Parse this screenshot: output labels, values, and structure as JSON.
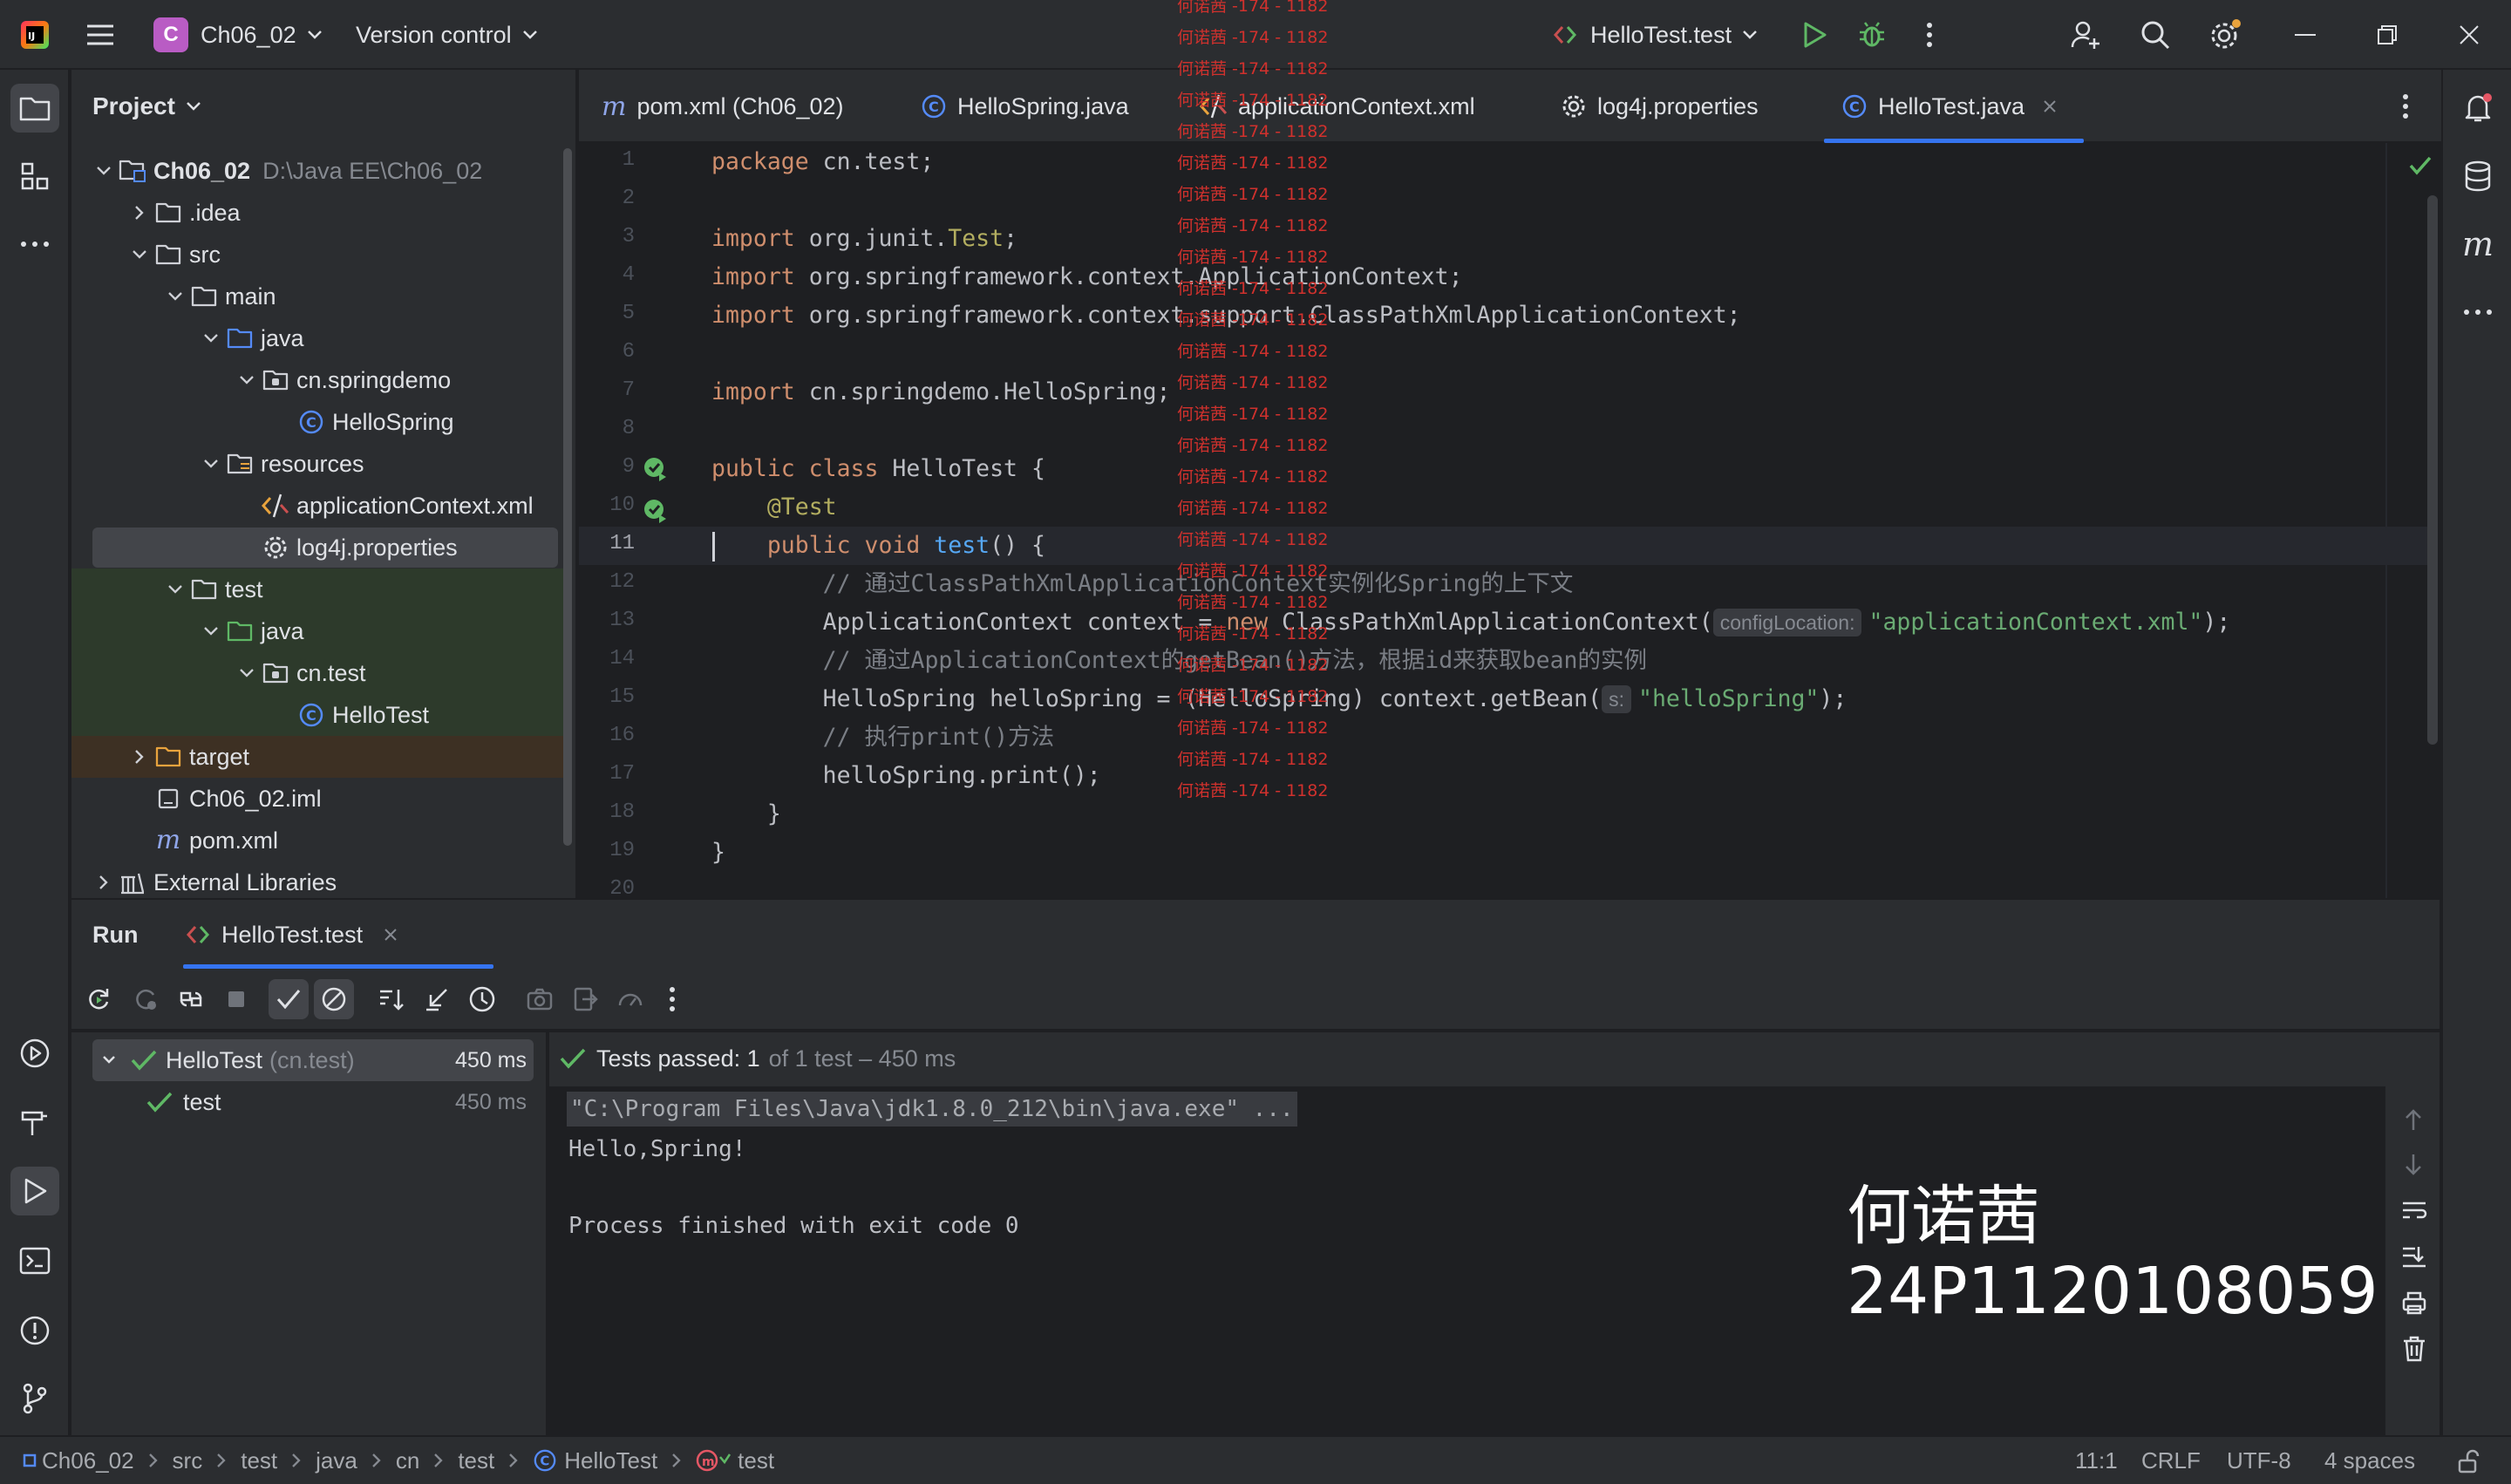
{
  "titlebar": {
    "project_badge": "C",
    "project_name": "Ch06_02",
    "vcs_label": "Version control",
    "run_config": "HelloTest.test"
  },
  "project_panel": {
    "title": "Project",
    "tree": [
      {
        "label": "Ch06_02",
        "extra": "D:\\Java EE\\Ch06_02",
        "icon": "module-folder-icon",
        "indent": 0,
        "state": "open"
      },
      {
        "label": ".idea",
        "icon": "folder-icon",
        "indent": 1,
        "state": "closed"
      },
      {
        "label": "src",
        "icon": "folder-icon",
        "indent": 1,
        "state": "open"
      },
      {
        "label": "main",
        "icon": "folder-icon",
        "indent": 2,
        "state": "open"
      },
      {
        "label": "java",
        "icon": "source-folder-icon",
        "indent": 3,
        "state": "open"
      },
      {
        "label": "cn.springdemo",
        "icon": "package-icon",
        "indent": 4,
        "state": "open"
      },
      {
        "label": "HelloSpring",
        "icon": "class-icon",
        "indent": 5,
        "state": "leaf"
      },
      {
        "label": "resources",
        "icon": "resources-folder-icon",
        "indent": 3,
        "state": "open"
      },
      {
        "label": "applicationContext.xml",
        "icon": "xml-file-icon",
        "indent": 4,
        "state": "leaf"
      },
      {
        "label": "log4j.properties",
        "icon": "properties-file-icon",
        "indent": 4,
        "state": "leaf",
        "selected": true
      },
      {
        "label": "test",
        "icon": "folder-icon",
        "indent": 2,
        "state": "open",
        "tint": "green"
      },
      {
        "label": "java",
        "icon": "test-folder-icon",
        "indent": 3,
        "state": "open",
        "tint": "green"
      },
      {
        "label": "cn.test",
        "icon": "package-icon",
        "indent": 4,
        "state": "open",
        "tint": "green"
      },
      {
        "label": "HelloTest",
        "icon": "class-icon",
        "indent": 5,
        "state": "leaf",
        "tint": "green"
      },
      {
        "label": "target",
        "icon": "excluded-folder-icon",
        "indent": 1,
        "state": "closed",
        "tint": "orange"
      },
      {
        "label": "Ch06_02.iml",
        "icon": "iml-file-icon",
        "indent": 1,
        "state": "leaf"
      },
      {
        "label": "pom.xml",
        "icon": "maven-icon",
        "indent": 1,
        "state": "leaf"
      },
      {
        "label": "External Libraries",
        "icon": "library-icon",
        "indent": 0,
        "state": "closed"
      }
    ]
  },
  "tabs": [
    {
      "label": "pom.xml (Ch06_02)",
      "icon": "maven-icon"
    },
    {
      "label": "HelloSpring.java",
      "icon": "class-icon"
    },
    {
      "label": "applicationContext.xml",
      "icon": "xml-file-icon"
    },
    {
      "label": "log4j.properties",
      "icon": "properties-file-icon"
    },
    {
      "label": "HelloTest.java",
      "icon": "class-icon",
      "active": true
    }
  ],
  "editor": {
    "line_numbers": [
      "1",
      "2",
      "3",
      "4",
      "5",
      "6",
      "7",
      "8",
      "9",
      "10",
      "11",
      "12",
      "13",
      "14",
      "15",
      "16",
      "17",
      "18",
      "19",
      "20"
    ],
    "current_line": "11",
    "lines": {
      "l1_kw": "package",
      "l1_rest": " cn.test;",
      "l3_kw": "import",
      "l3_pkg": " org.junit.",
      "l3_cls": "Test",
      "l3_end": ";",
      "l4_kw": "import",
      "l4_rest": " org.springframework.context.ApplicationContext;",
      "l5_kw": "import",
      "l5_rest": " org.springframework.context.support.ClassPathXmlApplicationContext;",
      "l7_kw": "import",
      "l7_rest": " cn.springdemo.HelloSpring;",
      "l9_kw": "public class",
      "l9_rest": " HelloTest {",
      "l10_ann": "@Test",
      "l11_kw": "public void",
      "l11_fn": "test",
      "l11_rest": "() {",
      "l12_cmt": "// 通过ClassPathXmlApplicationContext实例化Spring的上下文",
      "l13_a": "ApplicationContext context = ",
      "l13_kw": "new",
      "l13_b": " ClassPathXmlApplicationContext(",
      "l13_hint": "configLocation:",
      "l13_str": "\"applicationContext.xml\"",
      "l13_end": ");",
      "l14_cmt": "// 通过ApplicationContext的getBean()方法，根据id来获取bean的实例",
      "l15_a": "HelloSpring helloSpring = (HelloSpring) context.getBean(",
      "l15_hint": "s:",
      "l15_str": "\"helloSpring\"",
      "l15_end": ");",
      "l16_cmt": "// 执行print()方法",
      "l17": "helloSpring.print();",
      "l18": "}",
      "l19": "}"
    }
  },
  "run_panel": {
    "title": "Run",
    "tab_label": "HelloTest.test",
    "tree": [
      {
        "label": "HelloTest",
        "extra": "(cn.test)",
        "time": "450 ms"
      },
      {
        "label": "test",
        "time": "450 ms"
      }
    ],
    "summary_bold": "Tests passed: 1",
    "summary_rest": "of 1 test – 450 ms",
    "console": {
      "cmd": "\"C:\\Program Files\\Java\\jdk1.8.0_212\\bin\\java.exe\" ...",
      "out1": "Hello,Spring!",
      "out2": "Process finished with exit code 0"
    }
  },
  "statusbar": {
    "crumbs": [
      "Ch06_02",
      "src",
      "test",
      "java",
      "cn",
      "test",
      "HelloTest",
      "test"
    ],
    "position": "11:1",
    "line_sep": "CRLF",
    "encoding": "UTF-8",
    "indent": "4 spaces"
  },
  "overlay": {
    "name": "何诺茜",
    "id": "24P1120108059"
  },
  "watermark": "何诺茜 -174 - 1182",
  "colors": {
    "accent": "#3574f0",
    "pass_green": "#5fb865",
    "badge_purple": "#b95cc4",
    "watermark_red": "#d0312d"
  }
}
